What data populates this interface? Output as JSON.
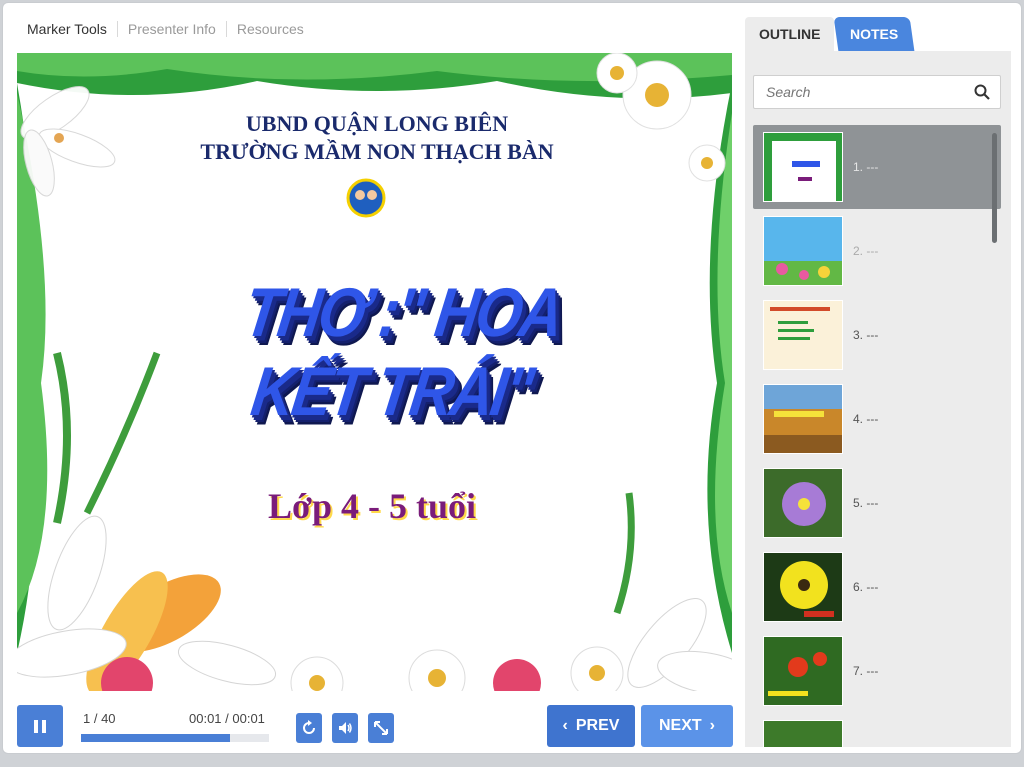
{
  "top_tabs": [
    "Marker Tools",
    "Presenter Info",
    "Resources"
  ],
  "slide": {
    "line1": "UBND QUẬN LONG BIÊN",
    "line2": "TRƯỜNG MẦM NON THẠCH BÀN",
    "title": "THƠ :\" HOA KẾT TRÁI\"",
    "subtitle": "Lớp 4 - 5 tuổi"
  },
  "controls": {
    "counter": "1 / 40",
    "time": "00:01 / 00:01",
    "progress": 0.79,
    "prev_label": "PREV",
    "next_label": "NEXT"
  },
  "sidebar": {
    "tabs": {
      "outline": "OUTLINE",
      "notes": "NOTES"
    },
    "search_placeholder": "Search",
    "items": [
      {
        "label": "1. ---"
      },
      {
        "label": "2. ---"
      },
      {
        "label": "3. ---"
      },
      {
        "label": "4. ---"
      },
      {
        "label": "5. ---"
      },
      {
        "label": "6. ---"
      },
      {
        "label": "7. ---"
      }
    ]
  },
  "colors": {
    "accent": "#4a7fd6",
    "active_item": "#8f9396",
    "slide_title": "#2f56e8"
  }
}
